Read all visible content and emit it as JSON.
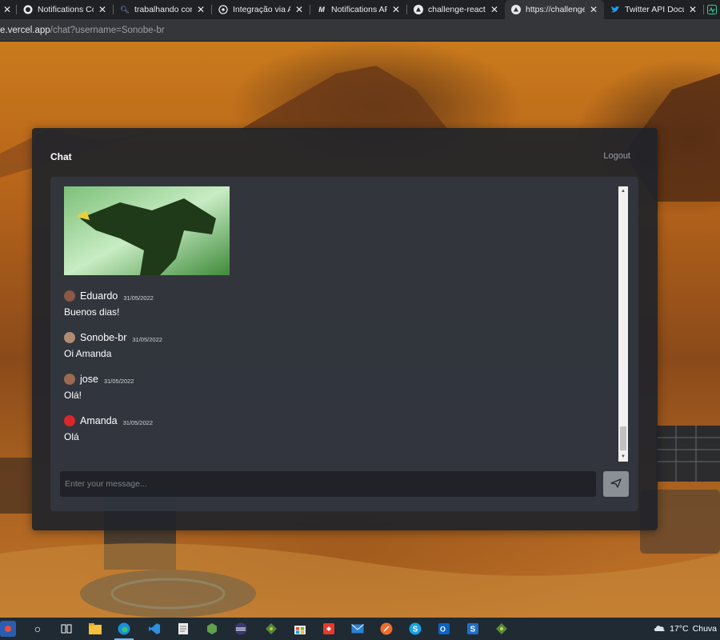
{
  "browser": {
    "tabs": [
      {
        "title": "",
        "icon": "close-only",
        "active": false
      },
      {
        "title": "Notifications Colle",
        "icon": "github-icon",
        "active": false
      },
      {
        "title": "trabalhando com A",
        "icon": "search-icon",
        "active": false
      },
      {
        "title": "Integração via APIs",
        "icon": "whatsapp-icon",
        "active": false
      },
      {
        "title": "Notifications API -",
        "icon": "mdn-icon",
        "active": false
      },
      {
        "title": "challenge-react – C",
        "icon": "vercel-icon",
        "active": false
      },
      {
        "title": "https://challenge-r",
        "icon": "vercel-icon",
        "active": true
      },
      {
        "title": "Twitter API Docum",
        "icon": "twitter-icon",
        "active": false
      }
    ],
    "url_host": "e.vercel.app",
    "url_path": "/chat?username=Sonobe-br"
  },
  "chat": {
    "title": "Chat",
    "logout_label": "Logout",
    "input_placeholder": "Enter your message...",
    "send_icon": "send-icon",
    "messages": [
      {
        "author": "Eduardo",
        "date": "31/05/2022",
        "text": "Buenos dias!",
        "avatar_color": "#8a5a44"
      },
      {
        "author": "Sonobe-br",
        "date": "31/05/2022",
        "text": "Oi Amanda",
        "avatar_color": "#b08c74"
      },
      {
        "author": "jose",
        "date": "31/05/2022",
        "text": "Olá!",
        "avatar_color": "#9c6a50"
      },
      {
        "author": "Amanda",
        "date": "31/05/2022",
        "text": "Olá",
        "avatar_color": "#d9262b"
      }
    ]
  },
  "taskbar": {
    "apps": [
      {
        "name": "cortana-icon",
        "glyph": "○"
      },
      {
        "name": "task-view-icon",
        "glyph": "⧉"
      },
      {
        "name": "file-explorer-icon",
        "glyph": "▬"
      },
      {
        "name": "edge-icon",
        "glyph": "◉"
      },
      {
        "name": "vscode-icon",
        "glyph": "⟨⟩"
      },
      {
        "name": "notepad-icon",
        "glyph": "▤"
      },
      {
        "name": "nodejs-icon",
        "glyph": "⬢"
      },
      {
        "name": "eclipse-icon",
        "glyph": "◑"
      },
      {
        "name": "git-icon",
        "glyph": "◆"
      },
      {
        "name": "store-icon",
        "glyph": "▦"
      },
      {
        "name": "anydesk-icon",
        "glyph": "◆"
      },
      {
        "name": "mail-icon",
        "glyph": "✉"
      },
      {
        "name": "postman-icon",
        "glyph": "◍"
      },
      {
        "name": "skype-icon",
        "glyph": "S"
      },
      {
        "name": "outlook-icon",
        "glyph": "O"
      },
      {
        "name": "sourcetree-icon",
        "glyph": "S"
      },
      {
        "name": "gitkraken-icon",
        "glyph": "◆"
      }
    ],
    "weather_temp": "17°C",
    "weather_text": "Chuva"
  }
}
